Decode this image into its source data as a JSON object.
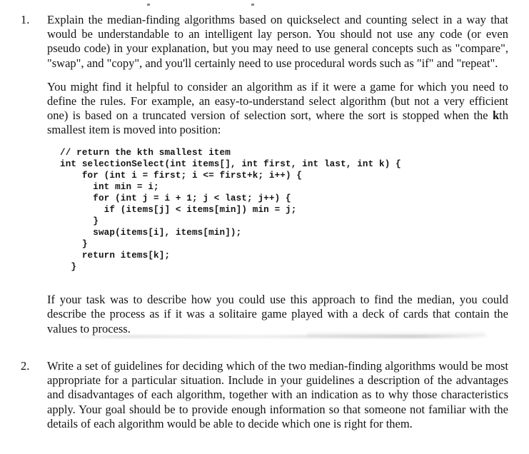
{
  "document": {
    "type": "scanned-assignment-page",
    "background_color": "#ffffff",
    "text_color": "#141414"
  },
  "items": [
    {
      "number": "1.",
      "paragraphs": [
        {
          "id": "q1-p1",
          "text": "Explain the median-finding algorithms based on quickselect and counting select in a way that would be understandable to an intelligent lay person.  You should not use any code (or even pseudo code) in your explanation, but you may need to use general concepts such as \"compare\", \"swap\", and \"copy\", and you'll certainly need to use procedural words such as \"if\" and \"repeat\"."
        },
        {
          "id": "q1-p2-a",
          "text": "You might find it helpful to consider an algorithm as if it were a game for which you need to define the rules.  For example, an easy-to-understand select algorithm (but not a very efficient one) is based on a truncated version of selection sort, where the sort is stopped when the "
        },
        {
          "id": "q1-p2-bold",
          "text": "k"
        },
        {
          "id": "q1-p2-b",
          "text": "th smallest item is moved into position:"
        },
        {
          "id": "q1-p3",
          "text": "If your task was to describe how you could use this approach to find the median, you could describe the process as if it was a solitaire game played with a deck of cards that contain the values to process."
        }
      ],
      "code": "// return the kth smallest item\nint selectionSelect(int items[], int first, int last, int k) {\n    for (int i = first; i <= first+k; i++) {\n      int min = i;\n      for (int j = i + 1; j < last; j++) {\n        if (items[j] < items[min]) min = j;\n      }\n      swap(items[i], items[min]);\n    }\n    return items[k];\n  }"
    },
    {
      "number": "2.",
      "paragraphs": [
        {
          "id": "q2-p1",
          "text": "Write a set of guidelines for deciding which of the two median-finding algorithms would be most appropriate for a particular situation.  Include in your guidelines a description of the advantages and disadvantages of each algorithm, together with an indication as to why those characteristics apply.  Your goal should be to provide enough information so that someone not familiar with the details of each algorithm would be able to decide which one is right for them."
        }
      ]
    }
  ],
  "artifacts": {
    "speckle_1": "scan-speckle",
    "speckle_2": "scan-speckle",
    "page_edge_shadow": "scan-shadow-line"
  }
}
